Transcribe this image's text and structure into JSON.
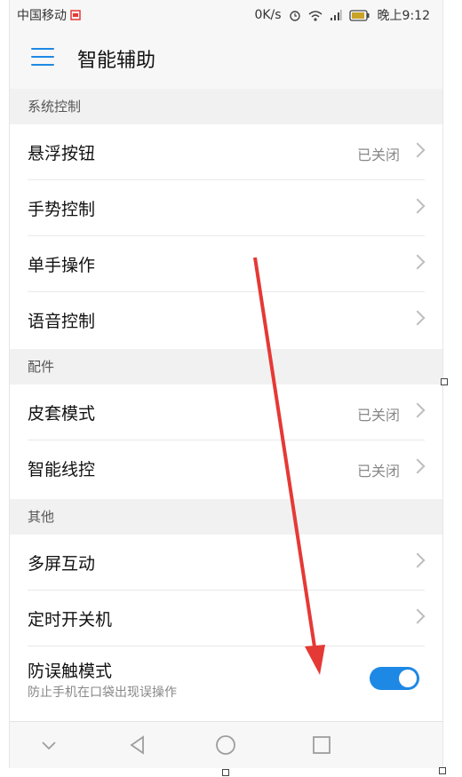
{
  "status_bar": {
    "carrier": "中国移动",
    "speed": "0K/s",
    "time": "晚上9:12"
  },
  "app_bar": {
    "title": "智能辅助",
    "menu_icon": "hamburger-menu-icon"
  },
  "sections": [
    {
      "header": "系统控制",
      "items": [
        {
          "label": "悬浮按钮",
          "value": "已关闭"
        },
        {
          "label": "手势控制",
          "value": ""
        },
        {
          "label": "单手操作",
          "value": ""
        },
        {
          "label": "语音控制",
          "value": ""
        }
      ]
    },
    {
      "header": "配件",
      "items": [
        {
          "label": "皮套模式",
          "value": "已关闭"
        },
        {
          "label": "智能线控",
          "value": "已关闭"
        }
      ]
    },
    {
      "header": "其他",
      "items": [
        {
          "label": "多屏互动",
          "value": ""
        },
        {
          "label": "定时开关机",
          "value": ""
        },
        {
          "label": "防误触模式",
          "subtitle": "防止手机在口袋出现误操作",
          "toggle_on": true
        }
      ]
    }
  ],
  "nav_bar": {
    "icons": [
      "chevron-down-icon",
      "back-icon",
      "home-icon",
      "recents-icon"
    ]
  },
  "colors": {
    "accent": "#1e88e5",
    "annotation_arrow": "#e53935"
  }
}
